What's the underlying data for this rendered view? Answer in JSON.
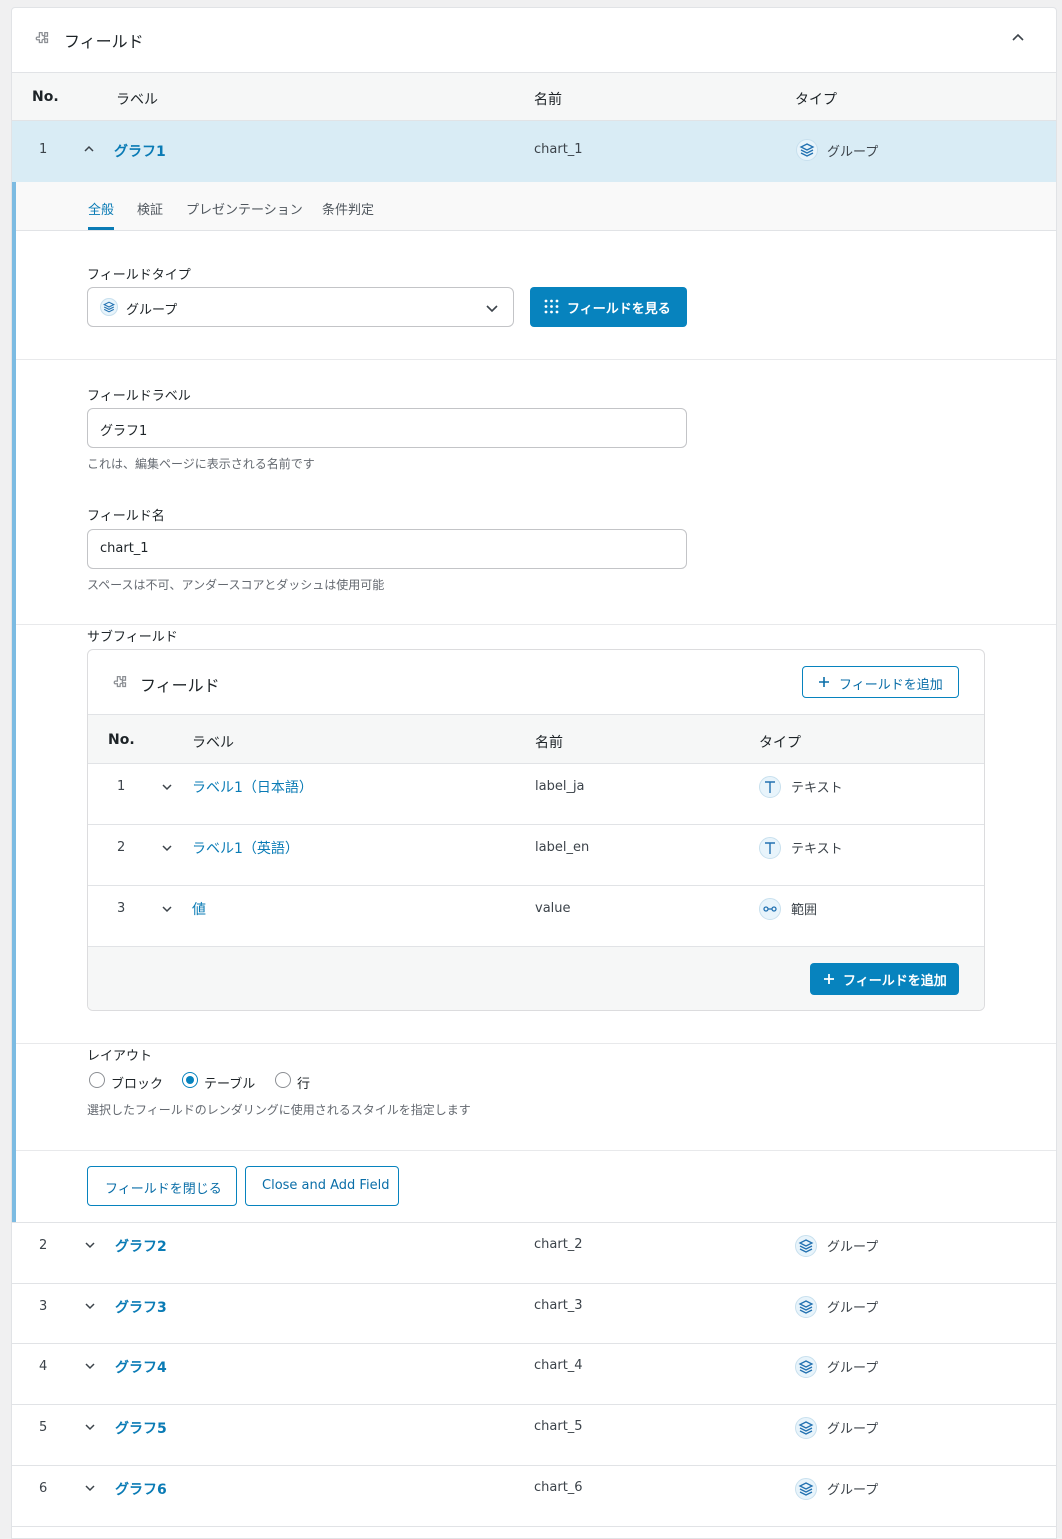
{
  "panel": {
    "title": "フィールド"
  },
  "table": {
    "headers": {
      "no": "No.",
      "label": "ラベル",
      "name": "名前",
      "type": "タイプ"
    }
  },
  "expanded_row": {
    "no": "1",
    "label": "グラフ1",
    "name": "chart_1",
    "type": "グループ"
  },
  "tabs": [
    "全般",
    "検証",
    "プレゼンテーション",
    "条件判定"
  ],
  "field_type": {
    "label": "フィールドタイプ",
    "value": "グループ",
    "browse_button": "フィールドを見る"
  },
  "field_label": {
    "label": "フィールドラベル",
    "value": "グラフ1",
    "help": "これは、編集ページに表示される名前です"
  },
  "field_name": {
    "label": "フィールド名",
    "value": "chart_1",
    "help": "スペースは不可、アンダースコアとダッシュは使用可能"
  },
  "subfields": {
    "label": "サブフィールド",
    "title": "フィールド",
    "add_button_top": "フィールドを追加",
    "add_button_bottom": "フィールドを追加",
    "headers": {
      "no": "No.",
      "label": "ラベル",
      "name": "名前",
      "type": "タイプ"
    },
    "rows": [
      {
        "no": "1",
        "label": "ラベル1（日本語）",
        "name": "label_ja",
        "type": "テキスト"
      },
      {
        "no": "2",
        "label": "ラベル1（英語）",
        "name": "label_en",
        "type": "テキスト"
      },
      {
        "no": "3",
        "label": "値",
        "name": "value",
        "type": "範囲"
      }
    ]
  },
  "layout": {
    "label": "レイアウト",
    "options": [
      "ブロック",
      "テーブル",
      "行"
    ],
    "selected": "テーブル",
    "help": "選択したフィールドのレンダリングに使用されるスタイルを指定します"
  },
  "actions": {
    "close": "フィールドを閉じる",
    "close_add": "Close and Add Field"
  },
  "rows": [
    {
      "no": "2",
      "label": "グラフ2",
      "name": "chart_2",
      "type": "グループ"
    },
    {
      "no": "3",
      "label": "グラフ3",
      "name": "chart_3",
      "type": "グループ"
    },
    {
      "no": "4",
      "label": "グラフ4",
      "name": "chart_4",
      "type": "グループ"
    },
    {
      "no": "5",
      "label": "グラフ5",
      "name": "chart_5",
      "type": "グループ"
    },
    {
      "no": "6",
      "label": "グラフ6",
      "name": "chart_6",
      "type": "グループ"
    }
  ],
  "colors": {
    "accent": "#0783be",
    "link": "#0a7bb5",
    "expanded_row_bg": "#d9ecf5",
    "left_border": "#7cbbe2"
  },
  "icons": {
    "panel": "puzzle-icon",
    "group": "layers-icon",
    "text": "text-t-icon",
    "range": "range-slider-icon",
    "grid": "grid-dots-icon",
    "plus": "plus-icon",
    "chevron_up": "chevron-up-icon",
    "chevron_down": "chevron-down-icon"
  }
}
